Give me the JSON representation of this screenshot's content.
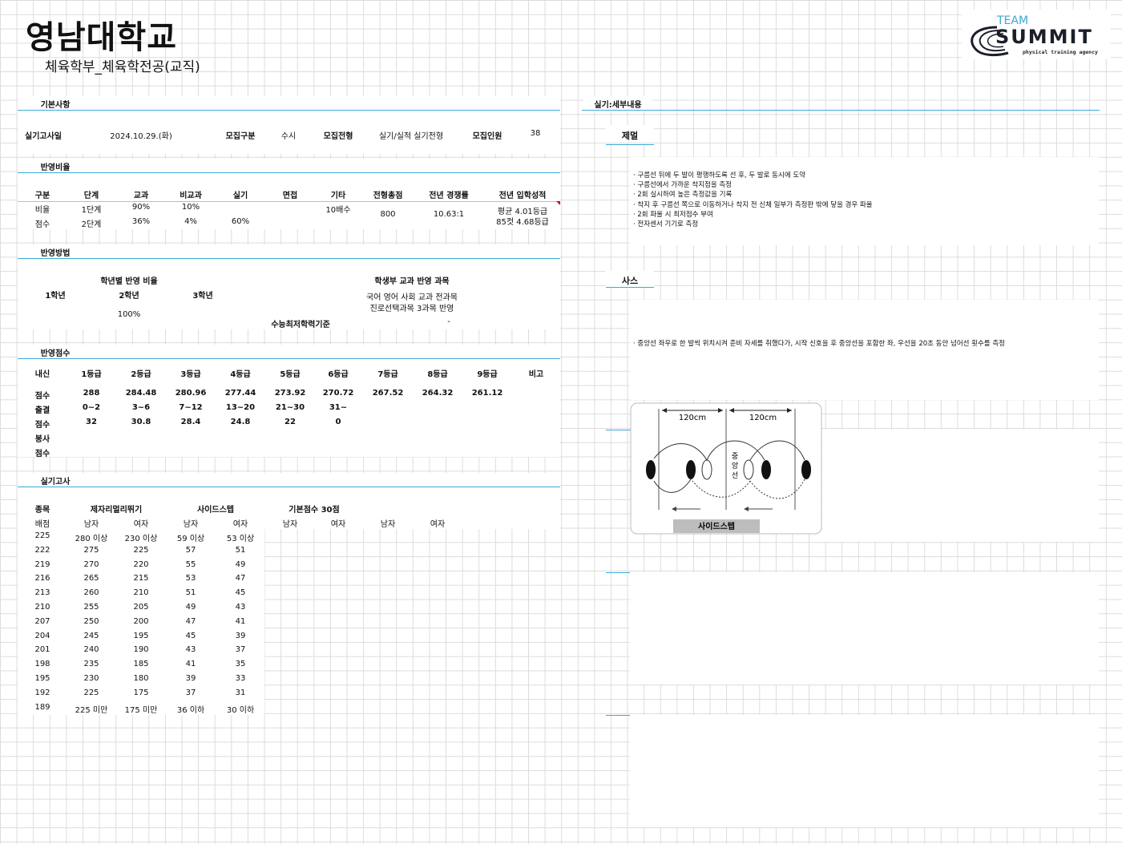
{
  "header": {
    "university": "영남대학교",
    "department": "체육학부_체육학전공(교직)",
    "logo": {
      "top": "TEAM",
      "main": "SUMMIT",
      "tagline": "physical training agency"
    }
  },
  "basic": {
    "section": "기본사항",
    "exam_date_label": "실기고사일",
    "exam_date": "2024.10.29.(화)",
    "type_label": "모집구분",
    "type": "수시",
    "track_label": "모집전형",
    "track": "실기/실적 실기전형",
    "quota_label": "모집인원",
    "quota": "38"
  },
  "ratio": {
    "section": "반영비율",
    "headers": [
      "구분",
      "단계",
      "교과",
      "비교과",
      "실기",
      "면접",
      "기타",
      "전형총점",
      "전년 경쟁률",
      "전년 입학성적"
    ],
    "row1": [
      "비율",
      "1단계",
      "90%",
      "10%",
      "",
      "",
      "10배수"
    ],
    "row2": [
      "점수",
      "2단계",
      "36%",
      "4%",
      "60%",
      "",
      ""
    ],
    "total": "800",
    "competition": "10.63:1",
    "admission_avg": "평균 4.01등급",
    "admission_cut": "85컷 4.68등급"
  },
  "method": {
    "section": "반영방법",
    "grade_ratio_label": "학년별 반영 비율",
    "grades": [
      "1학년",
      "2학년",
      "3학년"
    ],
    "grade_ratio": "100%",
    "subject_label": "학생부 교과 반영 과목",
    "subject_line1": "국어 영어 사회 교과 전과목",
    "subject_line2": "진로선택과목 3과목 반영",
    "csat_label": "수능최저학력기준",
    "csat": "-"
  },
  "scores": {
    "section": "반영점수",
    "headers": [
      "내신",
      "1등급",
      "2등급",
      "3등급",
      "4등급",
      "5등급",
      "6등급",
      "7등급",
      "8등급",
      "9등급",
      "비고"
    ],
    "rows": [
      [
        "점수",
        "288",
        "284.48",
        "280.96",
        "277.44",
        "273.92",
        "270.72",
        "267.52",
        "264.32",
        "261.12"
      ],
      [
        "출결",
        "0~2",
        "3~6",
        "7~12",
        "13~20",
        "21~30",
        "31~"
      ],
      [
        "점수",
        "32",
        "30.8",
        "28.4",
        "24.8",
        "22",
        "0"
      ],
      [
        "봉사"
      ],
      [
        "점수"
      ]
    ]
  },
  "practical": {
    "section": "실기고사",
    "event_label": "종목",
    "event1": "제자리멀리뛰기",
    "event2": "사이드스텝",
    "base_score": "기본점수 30점",
    "subheaders": [
      "배점",
      "남자",
      "여자",
      "남자",
      "여자",
      "남자",
      "여자",
      "남자",
      "여자"
    ],
    "rows": [
      [
        "225",
        "280 이상",
        "230 이상",
        "59 이상",
        "53 이상"
      ],
      [
        "222",
        "275",
        "225",
        "57",
        "51"
      ],
      [
        "219",
        "270",
        "220",
        "55",
        "49"
      ],
      [
        "216",
        "265",
        "215",
        "53",
        "47"
      ],
      [
        "213",
        "260",
        "210",
        "51",
        "45"
      ],
      [
        "210",
        "255",
        "205",
        "49",
        "43"
      ],
      [
        "207",
        "250",
        "200",
        "47",
        "41"
      ],
      [
        "204",
        "245",
        "195",
        "45",
        "39"
      ],
      [
        "201",
        "240",
        "190",
        "43",
        "37"
      ],
      [
        "198",
        "235",
        "185",
        "41",
        "35"
      ],
      [
        "195",
        "230",
        "180",
        "39",
        "33"
      ],
      [
        "192",
        "225",
        "175",
        "37",
        "31"
      ],
      [
        "189",
        "225 미만",
        "175 미만",
        "36 이하",
        "30 이하"
      ]
    ]
  },
  "detail": {
    "section": "실기:세부내용",
    "event1_title": "제멀",
    "event1_notes": [
      "· 구름선 뒤에 두 발이 평행하도록 선 후, 두 발로 동시에 도약",
      "· 구름선에서 가까운 착지점을 측정",
      "· 2회 실시하여 높은 측정값을 기록",
      "· 착지 후 구름선 쪽으로 이동하거나 착지 전 신체 일부가 측정판 밖에 닿을 경우 파울",
      "· 2회 파울 시 최저점수 부여",
      "· 전자센서 기기로 측정"
    ],
    "event2_title": "사스",
    "event2_notes": [
      "· 중앙선 좌우로 한 발씩 위치시켜 준비 자세를 취했다가, 시작 신호을 후 중앙선을 포함한 좌, 우선을 20초 동안 넘어선 횟수를 측정"
    ],
    "diagram": {
      "dist_left": "120cm",
      "dist_right": "120cm",
      "center_line": [
        "중",
        "앙",
        "선"
      ],
      "caption": "사이드스텝"
    }
  }
}
